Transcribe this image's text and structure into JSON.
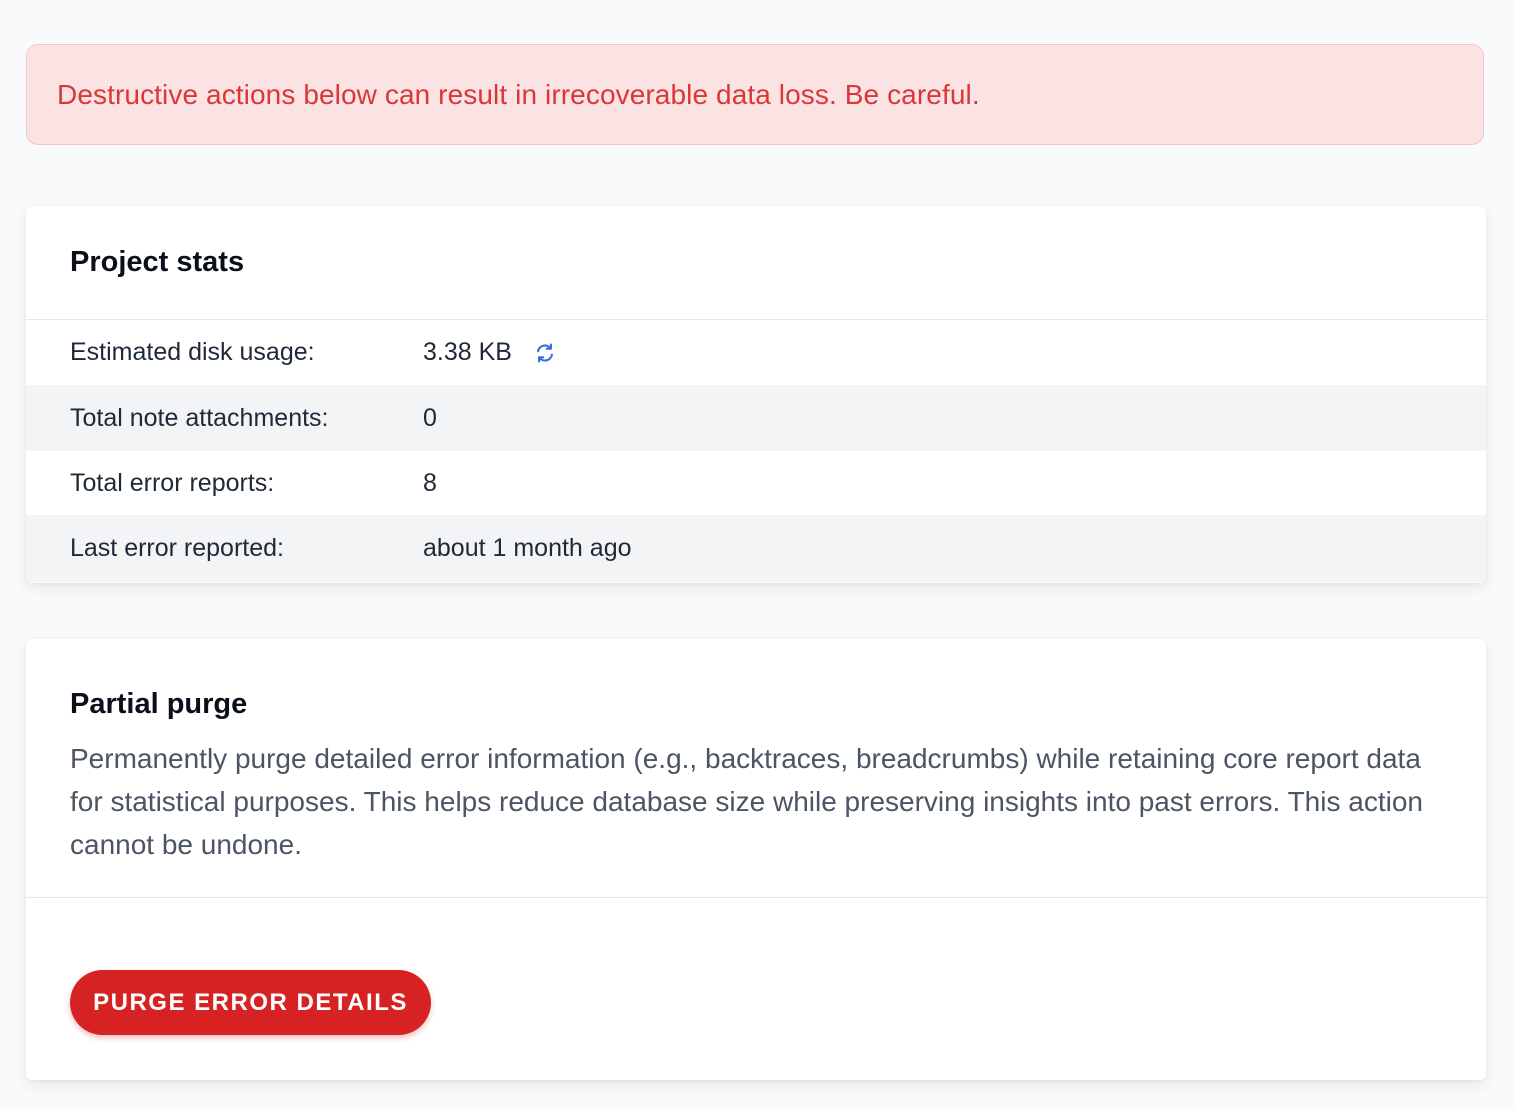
{
  "alert": {
    "message": "Destructive actions below can result in irrecoverable data loss. Be careful."
  },
  "project_stats": {
    "title": "Project stats",
    "rows": [
      {
        "label": "Estimated disk usage:",
        "value": "3.38 KB"
      },
      {
        "label": "Total note attachments:",
        "value": "0"
      },
      {
        "label": "Total error reports:",
        "value": "8"
      },
      {
        "label": "Last error reported:",
        "value": "about 1 month ago"
      }
    ],
    "refresh_icon": "refresh-icon"
  },
  "partial_purge": {
    "title": "Partial purge",
    "description": "Permanently purge detailed error information (e.g., backtraces, breadcrumbs) while retaining core report data for statistical purposes. This helps reduce database size while preserving insights into past errors. This action cannot be undone.",
    "button_label": "PURGE ERROR DETAILS"
  },
  "colors": {
    "alert_bg": "#fbe2e3",
    "alert_text": "#dc3737",
    "danger_button": "#d62222",
    "refresh_icon": "#3b6fe0"
  }
}
